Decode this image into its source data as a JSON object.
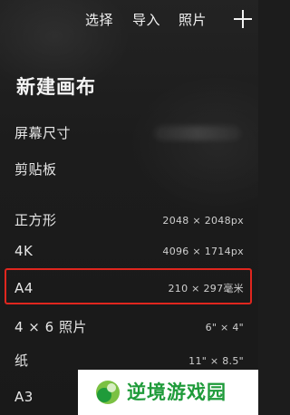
{
  "header": {
    "select_label": "选择",
    "import_label": "导入",
    "photos_label": "照片",
    "add_icon": "plus-icon"
  },
  "title": "新建画布",
  "canvas_presets": [
    {
      "name": "屏幕尺寸",
      "size": ""
    },
    {
      "name": "剪贴板",
      "size": ""
    },
    {
      "name": "正方形",
      "size": "2048 × 2048px"
    },
    {
      "name": "4K",
      "size": "4096 × 1714px"
    },
    {
      "name": "A4",
      "size": "210 × 297毫米"
    },
    {
      "name": "4 × 6 照片",
      "size": "6\" × 4\""
    },
    {
      "name": "纸",
      "size": "11\" × 8.5\""
    },
    {
      "name": "A3",
      "size": ""
    }
  ],
  "highlighted_preset": "A4",
  "colors": {
    "background": "#1c1c1c",
    "highlight_border": "#e0261e",
    "watermark_green": "#1f9b3a"
  },
  "watermark": {
    "text": "逆境游戏园"
  }
}
